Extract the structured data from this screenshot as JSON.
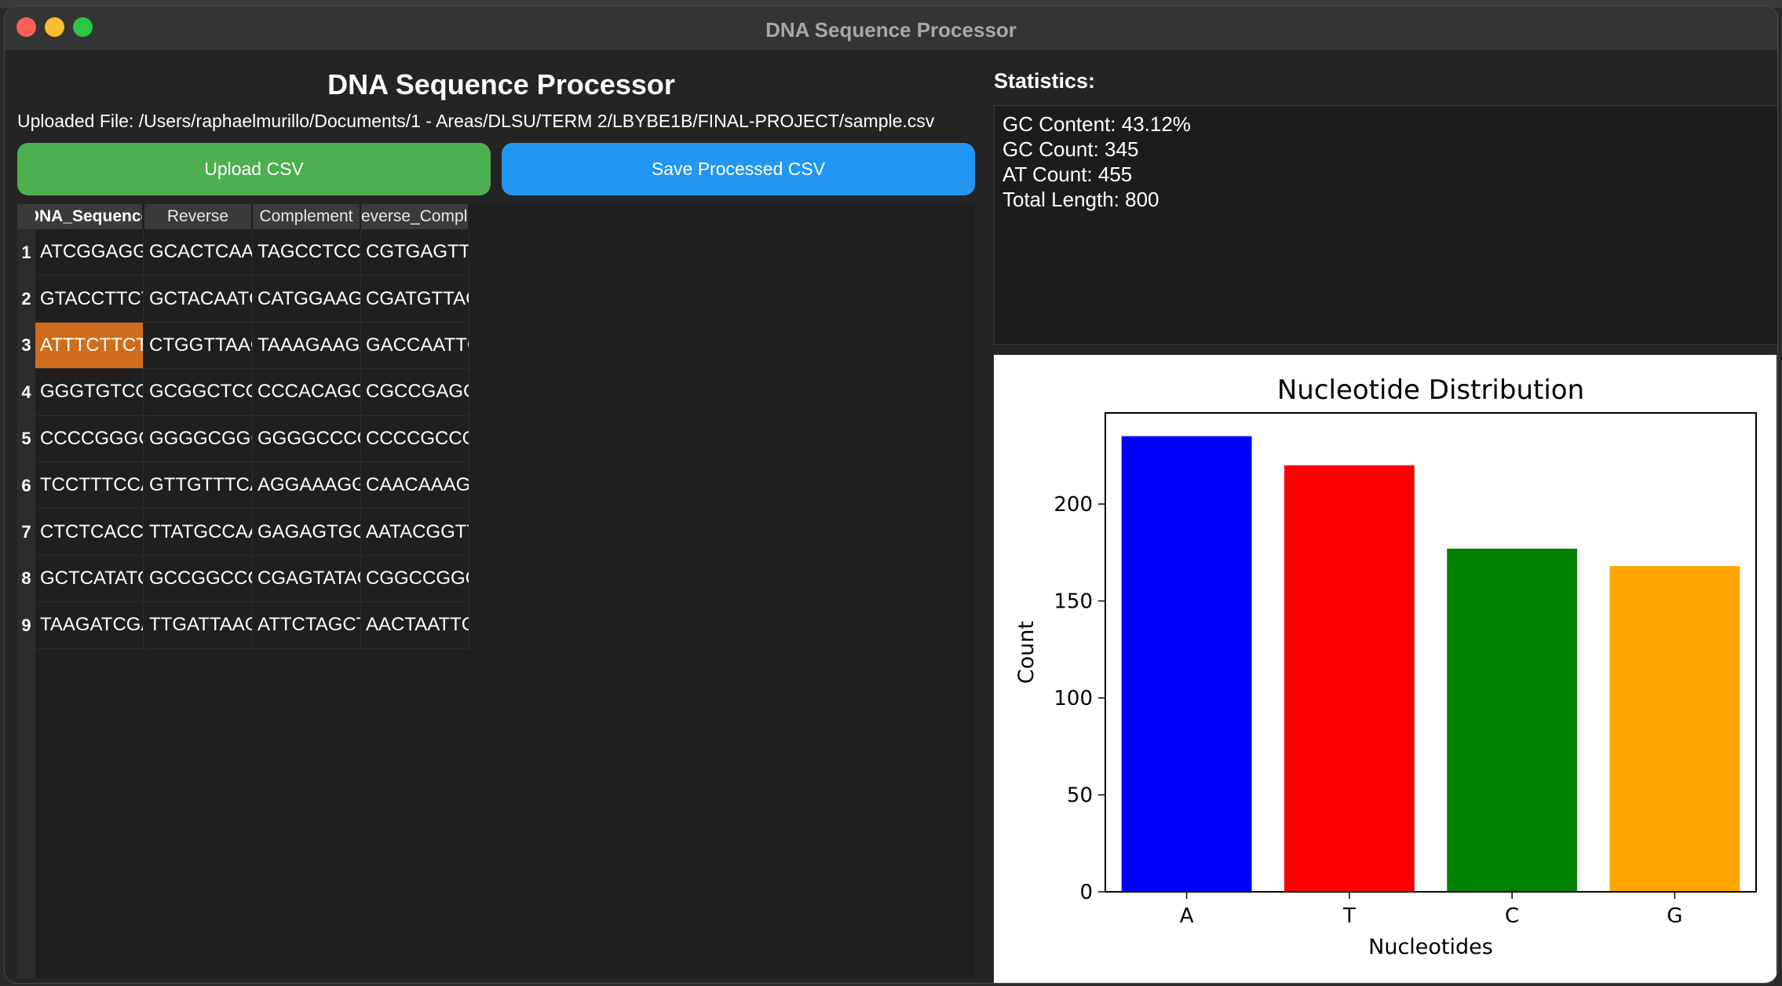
{
  "window": {
    "title": "DNA Sequence Processor"
  },
  "app": {
    "title": "DNA Sequence Processor",
    "uploaded_file_label": "Uploaded File: /Users/raphaelmurillo/Documents/1 - Areas/DLSU/TERM 2/LBYBE1B/FINAL-PROJECT/sample.csv"
  },
  "buttons": {
    "upload": "Upload CSV",
    "save": "Save Processed CSV"
  },
  "colors": {
    "upload": "#4caf50",
    "save": "#2196f3",
    "selected_cell": "#d06c1a"
  },
  "table": {
    "columns": [
      "DNA_Sequence",
      "Reverse",
      "Complement",
      "everse_Compleme"
    ],
    "rows": [
      {
        "index": "1",
        "cells": [
          "ATCGGAGGT...",
          "GCACTCAAC...",
          "TAGCCTCCA...",
          "CGTGAGTTG..."
        ]
      },
      {
        "index": "2",
        "cells": [
          "GTACCTTCT...",
          "GCTACAATC...",
          "CATGGAAGA...",
          "CGATGTTAG..."
        ]
      },
      {
        "index": "3",
        "cells": [
          "ATTTCTTCTA...",
          "CTGGTTAAC...",
          "TAAAGAAGA...",
          "GACCAATTG..."
        ]
      },
      {
        "index": "4",
        "cells": [
          "GGGTGTCGG...",
          "GCGGCTCCC...",
          "CCCACAGCC...",
          "CGCCGAGG..."
        ]
      },
      {
        "index": "5",
        "cells": [
          "CCCCGGGC...",
          "GGGGCGGC...",
          "GGGGCCCG...",
          "CCCCGCCG..."
        ]
      },
      {
        "index": "6",
        "cells": [
          "TCCTTTCCA...",
          "GTTGTTTCAT...",
          "AGGAAAGGT...",
          "CAACAAAGT..."
        ]
      },
      {
        "index": "7",
        "cells": [
          "CTCTCACCT...",
          "TTATGCCAA...",
          "GAGAGTGGA...",
          "AATACGGTT..."
        ]
      },
      {
        "index": "8",
        "cells": [
          "GCTCATATCC...",
          "GCCGGCCC...",
          "CGAGTATAG...",
          "CGGCCGGG..."
        ]
      },
      {
        "index": "9",
        "cells": [
          "TAAGATCGAT...",
          "TTGATTAAGC...",
          "ATTCTAGCTA...",
          "AACTAATTC..."
        ]
      }
    ],
    "selected": {
      "row": 2,
      "col": 0
    }
  },
  "stats": {
    "title": "Statistics:",
    "lines": [
      "GC Content: 43.12%",
      "GC Count: 345",
      "AT Count: 455",
      "Total Length: 800"
    ]
  },
  "chart_data": {
    "type": "bar",
    "title": "Nucleotide Distribution",
    "xlabel": "Nucleotides",
    "ylabel": "Count",
    "categories": [
      "A",
      "T",
      "C",
      "G"
    ],
    "values": [
      235,
      220,
      177,
      168
    ],
    "colors": [
      "#0000ff",
      "#ff0000",
      "#008000",
      "#ffa500"
    ],
    "ylim": [
      0,
      247
    ],
    "yticks": [
      0,
      50,
      100,
      150,
      200
    ],
    "grid": false
  }
}
